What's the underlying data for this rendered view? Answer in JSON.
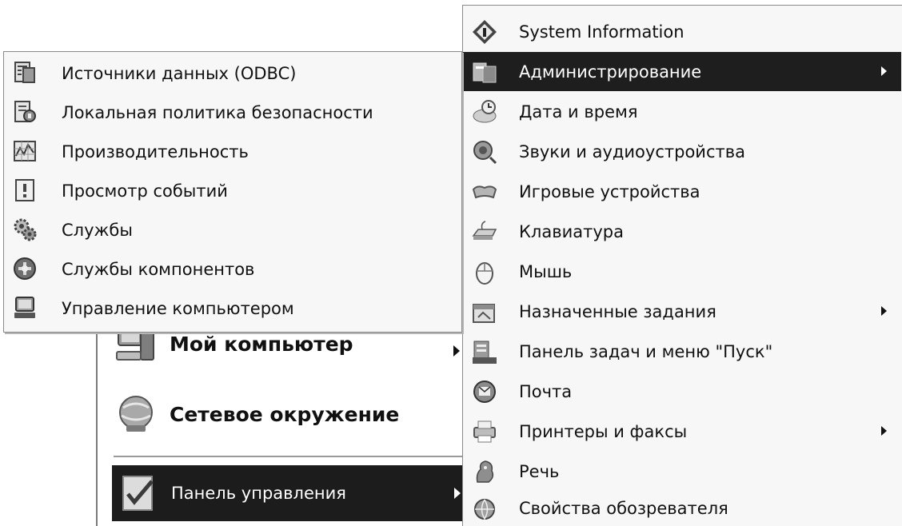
{
  "control_panel_menu": {
    "items": [
      {
        "label": "System Information",
        "icon": "system-information-icon",
        "has_submenu": false,
        "selected": false
      },
      {
        "label": "Администрирование",
        "icon": "administration-icon",
        "has_submenu": true,
        "selected": true
      },
      {
        "label": "Дата и время",
        "icon": "date-time-icon",
        "has_submenu": false,
        "selected": false
      },
      {
        "label": "Звуки и аудиоустройства",
        "icon": "sounds-icon",
        "has_submenu": false,
        "selected": false
      },
      {
        "label": "Игровые устройства",
        "icon": "game-controllers-icon",
        "has_submenu": false,
        "selected": false
      },
      {
        "label": "Клавиатура",
        "icon": "keyboard-icon",
        "has_submenu": false,
        "selected": false
      },
      {
        "label": "Мышь",
        "icon": "mouse-icon",
        "has_submenu": false,
        "selected": false
      },
      {
        "label": "Назначенные задания",
        "icon": "scheduled-tasks-icon",
        "has_submenu": true,
        "selected": false
      },
      {
        "label": "Панель задач и меню \"Пуск\"",
        "icon": "taskbar-start-menu-icon",
        "has_submenu": false,
        "selected": false
      },
      {
        "label": "Почта",
        "icon": "mail-icon",
        "has_submenu": false,
        "selected": false
      },
      {
        "label": "Принтеры и факсы",
        "icon": "printers-faxes-icon",
        "has_submenu": true,
        "selected": false
      },
      {
        "label": "Речь",
        "icon": "speech-icon",
        "has_submenu": false,
        "selected": false
      },
      {
        "label": "Свойства обозревателя",
        "icon": "internet-options-icon",
        "has_submenu": false,
        "selected": false
      }
    ]
  },
  "administration_menu": {
    "items": [
      {
        "label": "Источники данных (ODBC)",
        "icon": "odbc-data-sources-icon"
      },
      {
        "label": "Локальная политика безопасности",
        "icon": "local-security-policy-icon"
      },
      {
        "label": "Производительность",
        "icon": "performance-icon"
      },
      {
        "label": "Просмотр событий",
        "icon": "event-viewer-icon"
      },
      {
        "label": "Службы",
        "icon": "services-icon"
      },
      {
        "label": "Службы компонентов",
        "icon": "component-services-icon"
      },
      {
        "label": "Управление компьютером",
        "icon": "computer-management-icon"
      }
    ]
  },
  "start_menu": {
    "my_computer": "Мой компьютер",
    "network_places": "Сетевое окружение",
    "control_panel": "Панель управления"
  }
}
